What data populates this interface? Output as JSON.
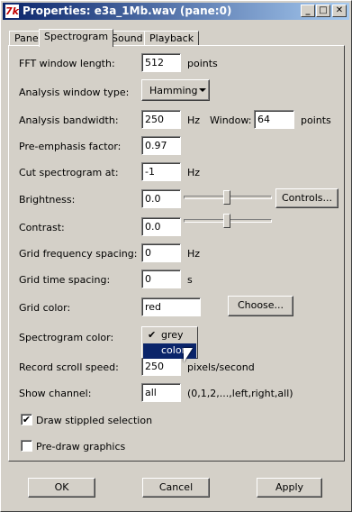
{
  "window": {
    "app_icon": "7k",
    "title": "Properties: e3a_1Mb.wav (pane:0)",
    "minimize_glyph": "_",
    "maximize_glyph": "□",
    "close_glyph": "✕"
  },
  "tabs": [
    "Pane",
    "Spectrogram",
    "Sound",
    "Playback"
  ],
  "active_tab": "Spectrogram",
  "form": {
    "fft": {
      "label": "FFT window length:",
      "value": "512",
      "unit": "points"
    },
    "analysis_window": {
      "label": "Analysis window type:",
      "value": "Hamming"
    },
    "bandwidth": {
      "label": "Analysis bandwidth:",
      "value": "250",
      "unit": "Hz",
      "window_label": "Window:",
      "window_value": "64",
      "window_unit": "points"
    },
    "preemphasis": {
      "label": "Pre-emphasis factor:",
      "value": "0.97"
    },
    "cut": {
      "label": "Cut spectrogram at:",
      "value": "-1",
      "unit": "Hz"
    },
    "brightness": {
      "label": "Brightness:",
      "value": "0.0",
      "button": "Controls..."
    },
    "contrast": {
      "label": "Contrast:",
      "value": "0.0"
    },
    "grid_freq": {
      "label": "Grid frequency spacing:",
      "value": "0",
      "unit": "Hz"
    },
    "grid_time": {
      "label": "Grid time spacing:",
      "value": "0",
      "unit": "s"
    },
    "grid_color": {
      "label": "Grid color:",
      "value": "red",
      "button": "Choose..."
    },
    "spectrogram_color": {
      "label": "Spectrogram color:",
      "options": [
        "grey",
        "color"
      ],
      "checked": "grey",
      "highlighted": "color",
      "check_glyph": "✔"
    },
    "scroll_speed": {
      "label": "Record scroll speed:",
      "value": "250",
      "unit": "pixels/second"
    },
    "show_channel": {
      "label": "Show channel:",
      "value": "all",
      "hint": "(0,1,2,...,left,right,all)"
    },
    "draw_stippled": {
      "label": "Draw stippled selection",
      "checked": true,
      "check_glyph": "✔"
    },
    "predraw": {
      "label": "Pre-draw graphics",
      "checked": false
    }
  },
  "buttons": {
    "ok": "OK",
    "cancel": "Cancel",
    "apply": "Apply"
  }
}
